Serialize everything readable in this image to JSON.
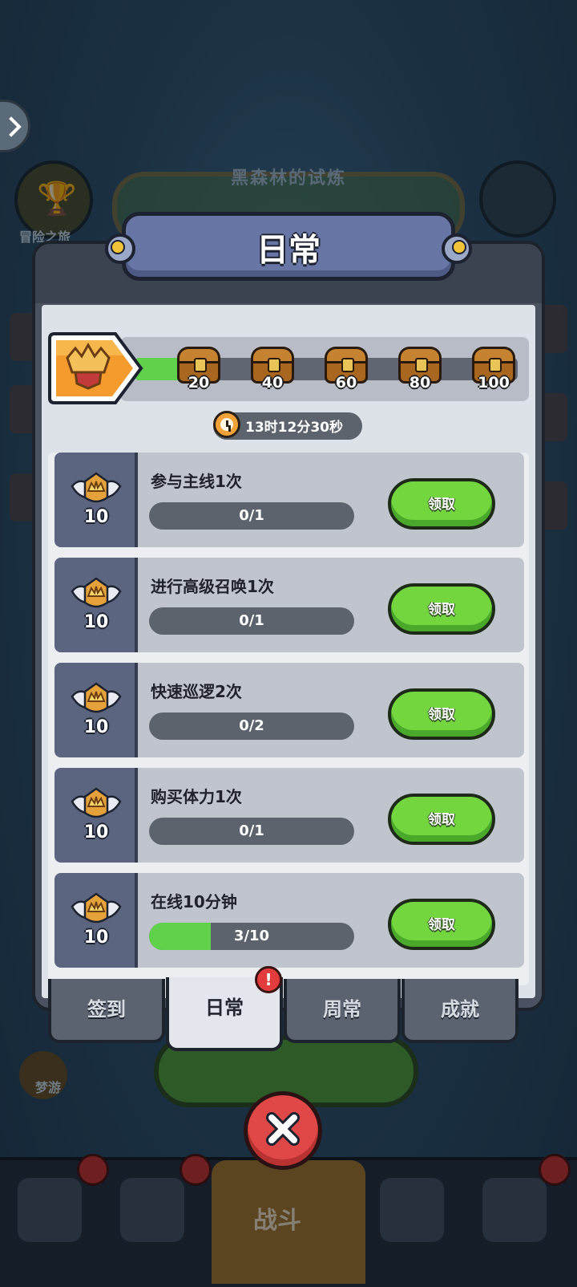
{
  "background": {
    "title": "黑森林的试炼",
    "trophy_label": "冒险之旅",
    "bottom_label": "战斗",
    "zz_label": "梦游"
  },
  "modal": {
    "title": "日常",
    "milestones": [
      "20",
      "40",
      "60",
      "80",
      "100"
    ],
    "progress_fraction": 0.12,
    "timer": "13时12分30秒",
    "tasks": [
      {
        "name": "参与主线1次",
        "points": "10",
        "progress": "0/1",
        "fraction": 0,
        "button": "领取"
      },
      {
        "name": "进行高级召唤1次",
        "points": "10",
        "progress": "0/1",
        "fraction": 0,
        "button": "领取"
      },
      {
        "name": "快速巡逻2次",
        "points": "10",
        "progress": "0/2",
        "fraction": 0,
        "button": "领取"
      },
      {
        "name": "购买体力1次",
        "points": "10",
        "progress": "0/1",
        "fraction": 0,
        "button": "领取"
      },
      {
        "name": "在线10分钟",
        "points": "10",
        "progress": "3/10",
        "fraction": 0.3,
        "button": "领取"
      }
    ],
    "tabs": [
      "签到",
      "日常",
      "周常",
      "成就"
    ],
    "active_tab": "日常"
  },
  "colors": {
    "accent_green": "#73d63f",
    "progress_green": "#5fd14a",
    "close_red": "#e04848",
    "title_plate": "#6876a6"
  }
}
